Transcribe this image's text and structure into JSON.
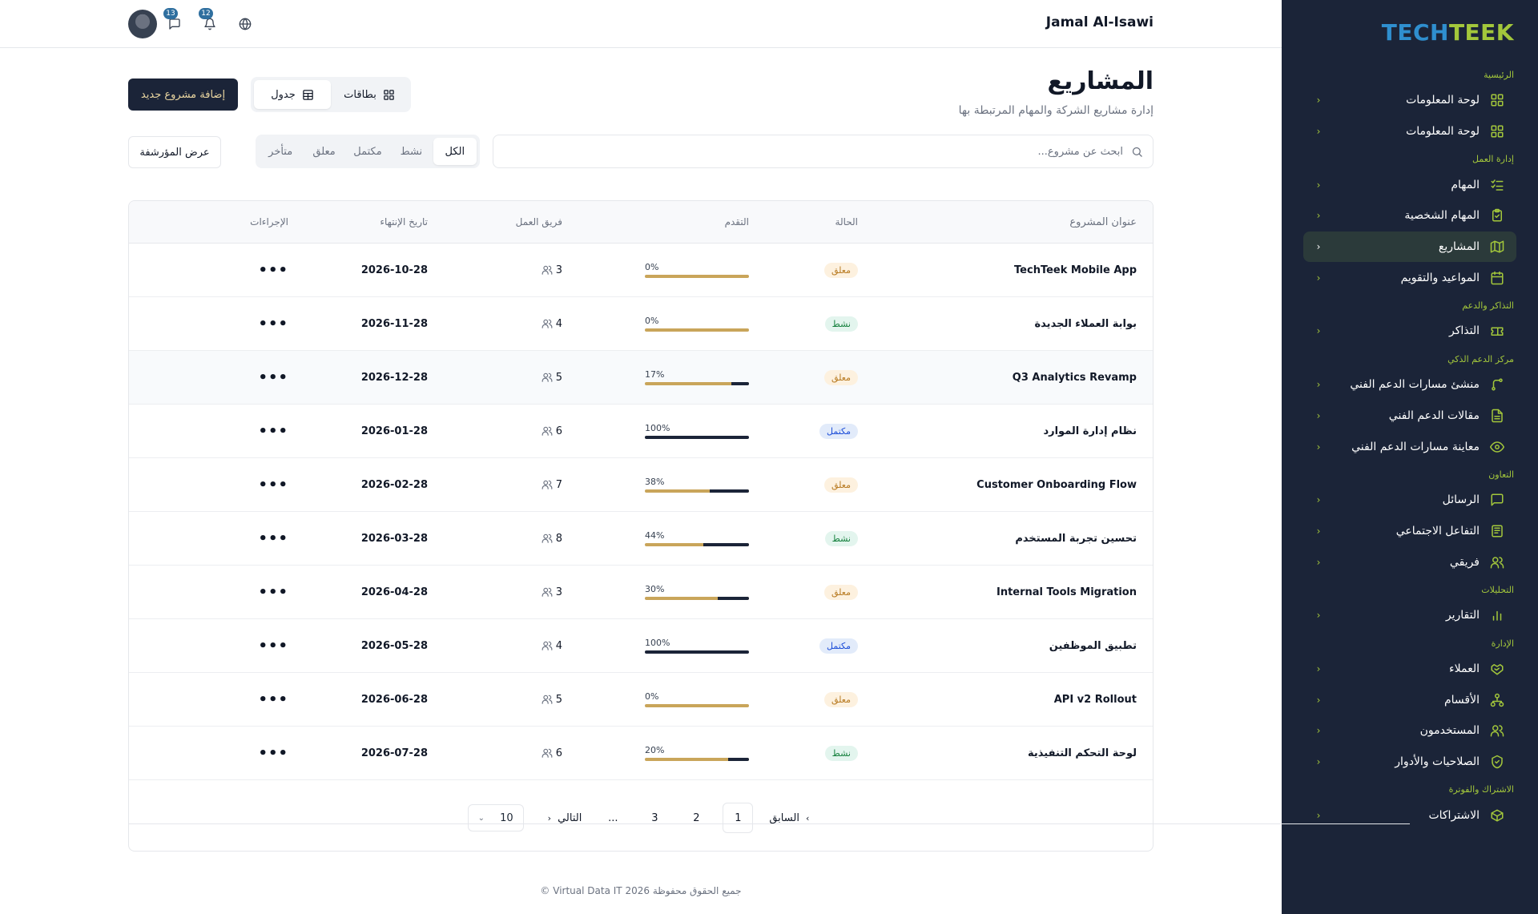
{
  "sidebar": {
    "logo_part1": "TECH",
    "logo_part2": "TEEK",
    "sections": [
      {
        "title": "الرئيسية",
        "items": [
          {
            "label": "لوحة المعلومات",
            "icon": "grid-icon"
          },
          {
            "label": "لوحة المعلومات",
            "icon": "grid-icon"
          }
        ]
      },
      {
        "title": "إدارة العمل",
        "items": [
          {
            "label": "المهام",
            "icon": "list-check-icon"
          },
          {
            "label": "المهام الشخصية",
            "icon": "clipboard-check-icon"
          },
          {
            "label": "المشاريع",
            "icon": "map-icon",
            "active": true
          },
          {
            "label": "المواعيد والتقويم",
            "icon": "calendar-icon"
          }
        ]
      },
      {
        "title": "التذاكر والدعم",
        "items": [
          {
            "label": "التذاكر",
            "icon": "ticket-icon"
          }
        ]
      },
      {
        "title": "مركز الدعم الذكي",
        "items": [
          {
            "label": "منشئ مسارات الدعم الفني",
            "icon": "route-icon"
          },
          {
            "label": "مقالات الدعم الفني",
            "icon": "file-text-icon"
          },
          {
            "label": "معاينة مسارات الدعم الفني",
            "icon": "eye-icon"
          }
        ]
      },
      {
        "title": "التعاون",
        "items": [
          {
            "label": "الرسائل",
            "icon": "message-icon"
          },
          {
            "label": "التفاعل الاجتماعي",
            "icon": "newspaper-icon"
          },
          {
            "label": "فريقي",
            "icon": "users-icon"
          }
        ]
      },
      {
        "title": "التحليلات",
        "items": [
          {
            "label": "التقارير",
            "icon": "bar-chart-icon"
          }
        ]
      },
      {
        "title": "الإدارة",
        "items": [
          {
            "label": "العملاء",
            "icon": "handshake-icon"
          },
          {
            "label": "الأقسام",
            "icon": "org-chart-icon"
          },
          {
            "label": "المستخدمون",
            "icon": "users-icon"
          },
          {
            "label": "الصلاحيات والأدوار",
            "icon": "shield-check-icon"
          }
        ]
      },
      {
        "title": "الاشتراك والفوترة",
        "items": [
          {
            "label": "الاشتراكات",
            "icon": "package-icon"
          }
        ]
      }
    ]
  },
  "header": {
    "username": "Jamal Al-Isawi",
    "messages_badge": "13",
    "notifications_badge": "12"
  },
  "page": {
    "title": "المشاريع",
    "subtitle": "إدارة مشاريع الشركة والمهام المرتبطة بها",
    "add_button": "إضافة مشروع جديد",
    "view_cards": "بطاقات",
    "view_table": "جدول",
    "search_placeholder": "ابحث عن مشروع...",
    "filters": [
      "الكل",
      "نشط",
      "مكتمل",
      "معلق",
      "متأخر"
    ],
    "archive_button": "عرض المؤرشفة"
  },
  "table": {
    "headers": {
      "title": "عنوان المشروع",
      "status": "الحالة",
      "progress": "التقدم",
      "team": "فريق العمل",
      "end_date": "تاريخ الإنتهاء",
      "actions": "الإجراءات"
    },
    "rows": [
      {
        "title": "TechTeek Mobile App",
        "status": "معلق",
        "status_type": "suspended",
        "progress": 0,
        "progress_label": "0%",
        "team": "3",
        "end_date": "2026-10-28"
      },
      {
        "title": "بوابة العملاء الجديدة",
        "status": "نشط",
        "status_type": "active",
        "progress": 0,
        "progress_label": "0%",
        "team": "4",
        "end_date": "2026-11-28"
      },
      {
        "title": "Q3 Analytics Revamp",
        "status": "معلق",
        "status_type": "suspended",
        "progress": 17,
        "progress_label": "17%",
        "team": "5",
        "end_date": "2026-12-28"
      },
      {
        "title": "نظام إدارة الموارد",
        "status": "مكتمل",
        "status_type": "done",
        "progress": 100,
        "progress_label": "100%",
        "team": "6",
        "end_date": "2026-01-28"
      },
      {
        "title": "Customer Onboarding Flow",
        "status": "معلق",
        "status_type": "suspended",
        "progress": 38,
        "progress_label": "38%",
        "team": "7",
        "end_date": "2026-02-28"
      },
      {
        "title": "تحسين تجربة المستخدم",
        "status": "نشط",
        "status_type": "active",
        "progress": 44,
        "progress_label": "44%",
        "team": "8",
        "end_date": "2026-03-28"
      },
      {
        "title": "Internal Tools Migration",
        "status": "معلق",
        "status_type": "suspended",
        "progress": 30,
        "progress_label": "30%",
        "team": "3",
        "end_date": "2026-04-28"
      },
      {
        "title": "تطبيق الموظفين",
        "status": "مكتمل",
        "status_type": "done",
        "progress": 100,
        "progress_label": "100%",
        "team": "4",
        "end_date": "2026-05-28"
      },
      {
        "title": "API v2 Rollout",
        "status": "معلق",
        "status_type": "suspended",
        "progress": 0,
        "progress_label": "0%",
        "team": "5",
        "end_date": "2026-06-28"
      },
      {
        "title": "لوحة التحكم التنفيذية",
        "status": "نشط",
        "status_type": "active",
        "progress": 20,
        "progress_label": "20%",
        "team": "6",
        "end_date": "2026-07-28"
      }
    ]
  },
  "pagination": {
    "prev": "السابق",
    "next": "التالي",
    "pages": [
      "1",
      "2",
      "3"
    ],
    "ellipsis": "...",
    "current": "1",
    "page_size": "10"
  },
  "footer": {
    "text": "جميع الحقوق محفوظة 2026 Virtual Data IT ©"
  },
  "colors": {
    "sidebar_bg": "#1b2438",
    "accent_green": "#a3c73b",
    "accent_blue": "#2f8fcf",
    "progress_track": "#c9a55a",
    "progress_fill": "#1b2438"
  }
}
